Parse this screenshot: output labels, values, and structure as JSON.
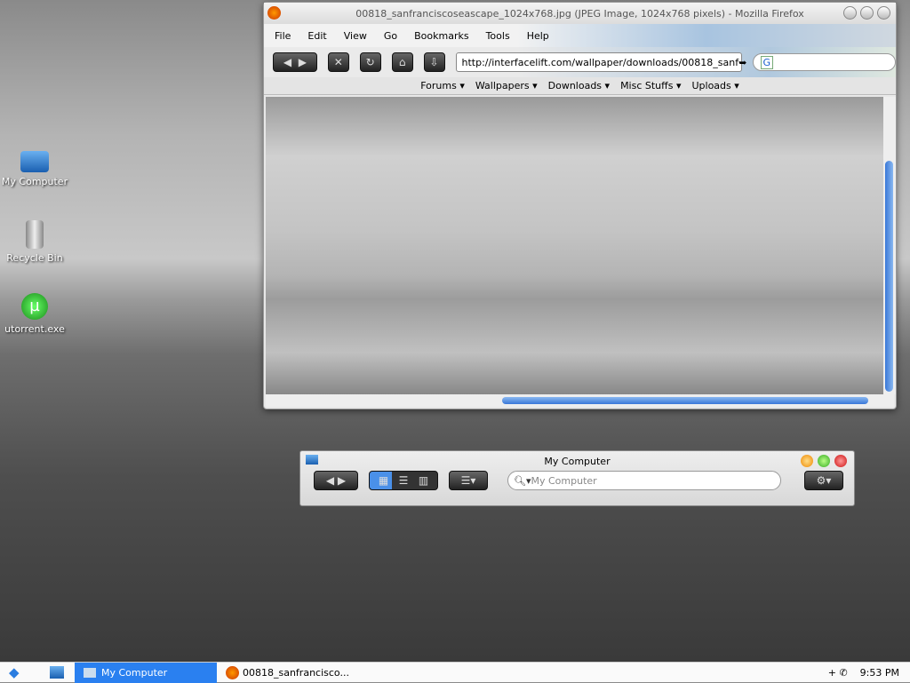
{
  "desktop": {
    "icons": [
      {
        "label": "My Computer"
      },
      {
        "label": "Recycle Bin"
      },
      {
        "label": "utorrent.exe"
      }
    ]
  },
  "firefox": {
    "title": "00818_sanfranciscoseascape_1024x768.jpg (JPEG Image, 1024x768 pixels) - Mozilla Firefox",
    "menu": [
      "File",
      "Edit",
      "View",
      "Go",
      "Bookmarks",
      "Tools",
      "Help"
    ],
    "url": "http://interfacelift.com/wallpaper/downloads/00818_sanf",
    "search_engine": "G",
    "site_nav": [
      "Forums ▾",
      "Wallpapers ▾",
      "Downloads ▾",
      "Misc Stuffs ▾",
      "Uploads ▾"
    ]
  },
  "explorer": {
    "title": "My Computer",
    "search_placeholder": "My Computer"
  },
  "taskbar": {
    "items": [
      "My Computer",
      "00818_sanfrancisco..."
    ],
    "clock": "9:53 PM"
  }
}
